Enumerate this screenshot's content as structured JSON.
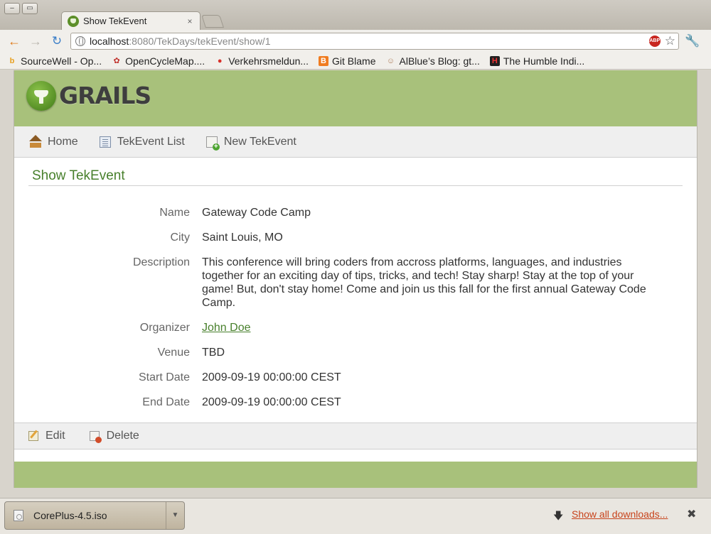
{
  "browser": {
    "window_buttons": [
      "–",
      "▭"
    ],
    "tab": {
      "title": "Show TekEvent",
      "close": "×"
    },
    "url": {
      "host": "localhost",
      "rest": ":8080/TekDays/tekEvent/show/1"
    },
    "abp_badge": "ABP",
    "icons": {
      "back": "←",
      "forward": "→",
      "reload": "↻",
      "star": "☆",
      "wrench": "🔧"
    },
    "bookmarks": [
      {
        "label": "SourceWell - Op...",
        "icon": "b",
        "color": "#e8a020"
      },
      {
        "label": "OpenCycleMap....",
        "icon": "✿",
        "color": "#c0302a"
      },
      {
        "label": "Verkehrsmeldun...",
        "icon": "●",
        "color": "#d8302a"
      },
      {
        "label": "Git Blame",
        "icon": "B",
        "color": "#f07c20"
      },
      {
        "label": "AlBlue’s Blog: gt...",
        "icon": "☺",
        "color": "#b08060"
      },
      {
        "label": "The Humble Indi...",
        "icon": "H",
        "color": "#202020"
      }
    ]
  },
  "site": {
    "logo_text": "GRAILS",
    "nav": [
      {
        "label": "Home"
      },
      {
        "label": "TekEvent List"
      },
      {
        "label": "New TekEvent"
      }
    ],
    "page_title": "Show TekEvent",
    "details": [
      {
        "label": "Name",
        "value": "Gateway Code Camp"
      },
      {
        "label": "City",
        "value": "Saint Louis, MO"
      },
      {
        "label": "Description",
        "value": "This conference will bring coders from accross platforms, languages, and industries together for an exciting day of tips, tricks, and tech! Stay sharp! Stay at the top of your game! But, don't stay home! Come and join us this fall for the first annual Gateway Code Camp."
      },
      {
        "label": "Organizer",
        "value": "John Doe"
      },
      {
        "label": "Venue",
        "value": "TBD"
      },
      {
        "label": "Start Date",
        "value": "2009-09-19 00:00:00 CEST"
      },
      {
        "label": "End Date",
        "value": "2009-09-19 00:00:00 CEST"
      }
    ],
    "buttons": {
      "edit": "Edit",
      "delete": "Delete"
    }
  },
  "downloads": {
    "item": {
      "name": "CorePlus-4.5.iso",
      "menu": "▼"
    },
    "arrow": "🡇",
    "show_all": "Show all downloads...",
    "close": "✖"
  },
  "colors": {
    "header_green": "#a8c17b",
    "title_green": "#48802c",
    "link_green": "#48802c"
  }
}
